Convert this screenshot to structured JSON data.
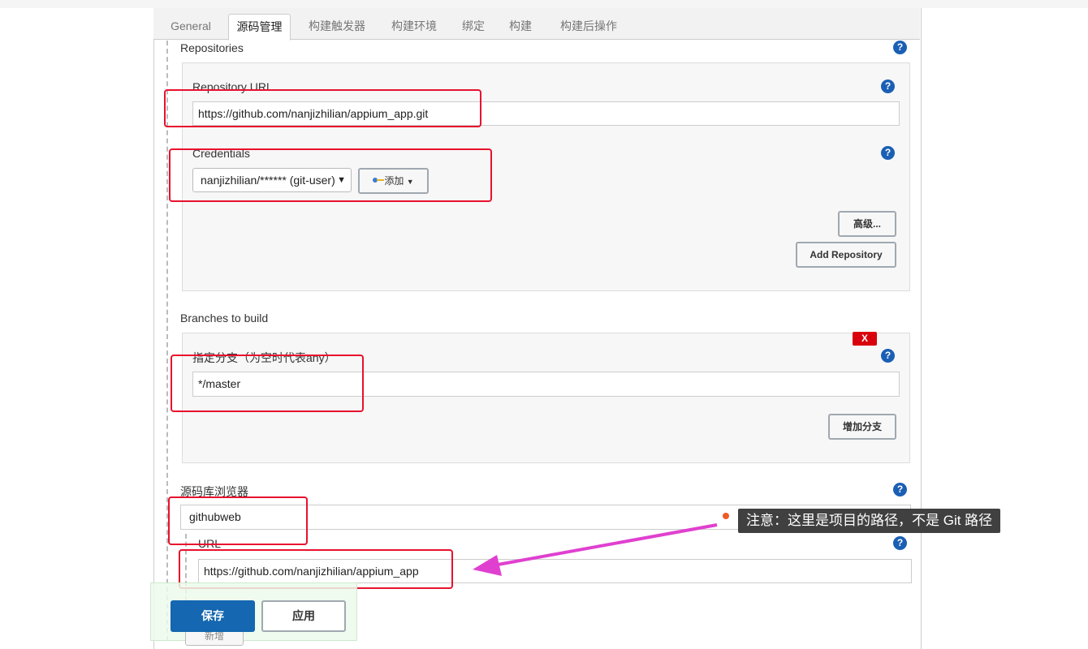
{
  "tabs": [
    {
      "label": "General"
    },
    {
      "label": "源码管理"
    },
    {
      "label": "构建触发器"
    },
    {
      "label": "构建环境"
    },
    {
      "label": "绑定"
    },
    {
      "label": "构建"
    },
    {
      "label": "构建后操作"
    }
  ],
  "repositories": {
    "section_label": "Repositories",
    "url_label": "Repository URL",
    "url_value": "https://github.com/nanjizhilian/appium_app.git",
    "credentials_label": "Credentials",
    "credentials_value": "nanjizhilian/****** (git-user)",
    "add_label": "添加",
    "advanced_label": "高级...",
    "add_repository_label": "Add Repository"
  },
  "branches": {
    "section_label": "Branches to build",
    "remove_label": "X",
    "branch_label": "指定分支（为空时代表any）",
    "branch_value": "*/master",
    "add_branch_label": "增加分支"
  },
  "browser": {
    "section_label": "源码库浏览器",
    "value": "githubweb",
    "url_label": "URL",
    "url_value": "https://github.com/nanjizhilian/appium_app"
  },
  "annotation": {
    "note": "注意：这里是项目的路径，不是 Git 路径",
    "color": "#e040d0"
  },
  "footer": {
    "save_label": "保存",
    "apply_label": "应用",
    "hidden_button_label": "新增"
  },
  "colors": {
    "highlight": "#e8112d",
    "primary": "#1467b0",
    "help": "#1a5fb4"
  }
}
